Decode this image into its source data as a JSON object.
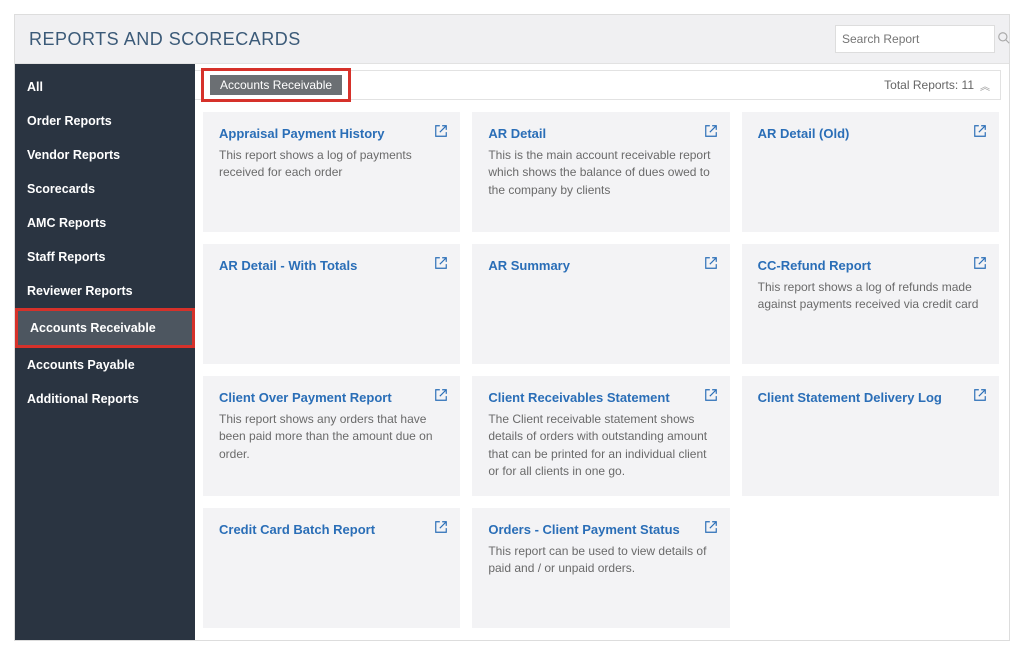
{
  "header": {
    "title": "REPORTS AND SCORECARDS",
    "search_placeholder": "Search Report"
  },
  "sidebar": {
    "items": [
      {
        "label": "All",
        "active": false
      },
      {
        "label": "Order Reports",
        "active": false
      },
      {
        "label": "Vendor Reports",
        "active": false
      },
      {
        "label": "Scorecards",
        "active": false
      },
      {
        "label": "AMC Reports",
        "active": false
      },
      {
        "label": "Staff Reports",
        "active": false
      },
      {
        "label": "Reviewer Reports",
        "active": false
      },
      {
        "label": "Accounts Receivable",
        "active": true
      },
      {
        "label": "Accounts Payable",
        "active": false
      },
      {
        "label": "Additional Reports",
        "active": false
      }
    ]
  },
  "subheader": {
    "tag": "Accounts Receivable",
    "total_label": "Total Reports: 11"
  },
  "reports": [
    {
      "title": "Appraisal Payment History",
      "desc": "This report shows a log of payments received for each order"
    },
    {
      "title": "AR Detail",
      "desc": "This is the main account receivable report which shows the balance of dues owed to the company by clients"
    },
    {
      "title": "AR Detail (Old)",
      "desc": ""
    },
    {
      "title": "AR Detail - With Totals",
      "desc": ""
    },
    {
      "title": "AR Summary",
      "desc": ""
    },
    {
      "title": "CC-Refund Report",
      "desc": "This report shows a log of refunds made against payments received via credit card"
    },
    {
      "title": "Client Over Payment Report",
      "desc": "This report shows any orders that have been paid more than the amount due on order."
    },
    {
      "title": "Client Receivables Statement",
      "desc": "The Client receivable statement shows details of orders with outstanding amount that can be printed for an individual client or for all clients in one go."
    },
    {
      "title": "Client Statement Delivery Log",
      "desc": ""
    },
    {
      "title": "Credit Card Batch Report",
      "desc": ""
    },
    {
      "title": "Orders - Client Payment Status",
      "desc": "This report can be used to view details of paid and / or unpaid orders."
    }
  ]
}
